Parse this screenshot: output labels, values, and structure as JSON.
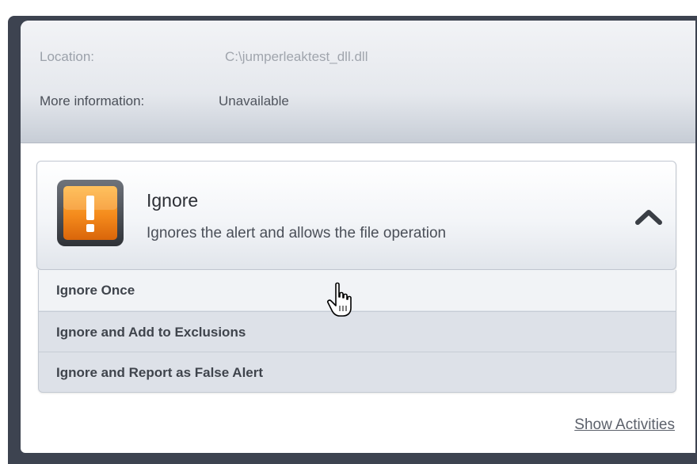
{
  "info": {
    "location_label": "Location:",
    "location_value": "C:\\jumperleaktest_dll.dll",
    "more_info_label": "More information:",
    "more_info_value": "Unavailable"
  },
  "action": {
    "icon": "warning-exclamation-icon",
    "title": "Ignore",
    "description": "Ignores the alert and allows the file operation",
    "toggle_icon": "chevron-up-icon"
  },
  "options": [
    {
      "label": "Ignore Once"
    },
    {
      "label": "Ignore and Add to Exclusions"
    },
    {
      "label": "Ignore and Report as False Alert"
    }
  ],
  "footer": {
    "show_activities": "Show Activities"
  },
  "colors": {
    "accent_orange": "#f28a1b",
    "frame_dark": "#3d4350"
  }
}
